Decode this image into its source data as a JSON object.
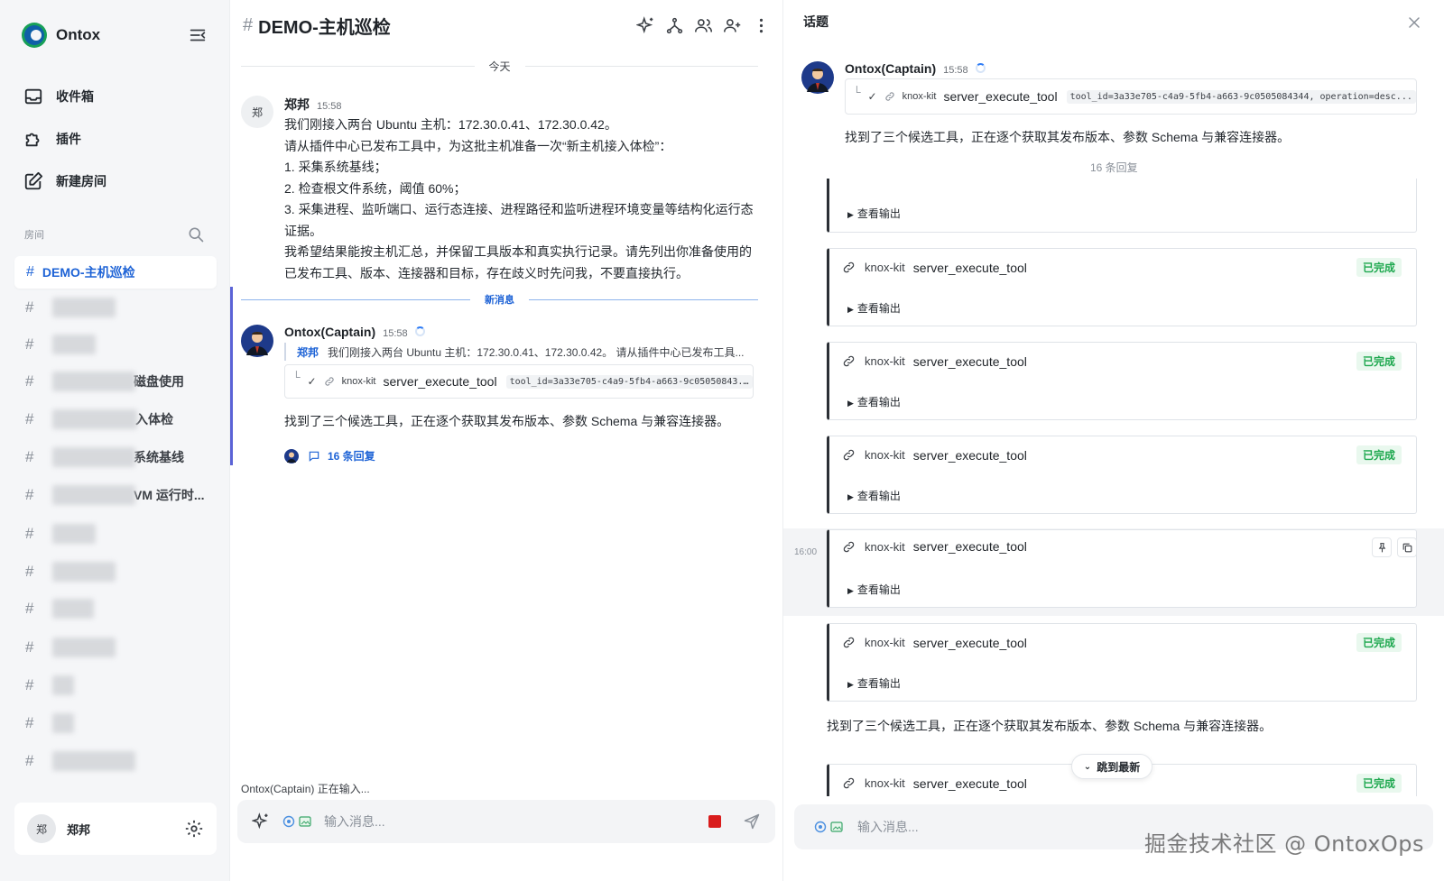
{
  "app": {
    "name": "Ontox"
  },
  "sidebar": {
    "nav": [
      {
        "label": "收件箱",
        "icon": "inbox-icon"
      },
      {
        "label": "插件",
        "icon": "puzzle-icon"
      },
      {
        "label": "新建房间",
        "icon": "edit-icon"
      }
    ],
    "rooms_header": "房间",
    "active_room": "DEMO-主机巡检",
    "rooms": [
      {
        "tail": ""
      },
      {
        "tail": ""
      },
      {
        "tail": "磁盘使用"
      },
      {
        "tail": "入体检"
      },
      {
        "tail": "系统基线"
      },
      {
        "tail": "VM 运行时..."
      },
      {
        "tail": ""
      },
      {
        "tail": ""
      },
      {
        "tail": ""
      },
      {
        "tail": ""
      },
      {
        "tail": ""
      },
      {
        "tail": ""
      },
      {
        "tail": ""
      }
    ],
    "user": {
      "avatar_letter": "郑",
      "name": "郑邦"
    }
  },
  "chat": {
    "title": "DEMO-主机巡检",
    "date_divider": "今天",
    "new_divider": "新消息",
    "user_msg": {
      "avatar_letter": "郑",
      "name": "郑邦",
      "time": "15:58",
      "lines": [
        "我们刚接入两台 Ubuntu 主机：172.30.0.41、172.30.0.42。",
        "请从插件中心已发布工具中，为这批主机准备一次“新主机接入体检”：",
        "1. 采集系统基线；",
        "2. 检查根文件系统，阈值 60%；",
        "3. 采集进程、监听端口、运行态连接、进程路径和监听进程环境变量等结构化运行态证据。",
        "我希望结果能按主机汇总，并保留工具版本和真实执行记录。请先列出你准备使用的已发布工具、版本、连接器和目标，存在歧义时先问我，不要直接执行。"
      ]
    },
    "bot_msg": {
      "name": "Ontox(Captain)",
      "time": "15:58",
      "quote_name": "郑邦",
      "quote_text": "我们刚接入两台 Ubuntu 主机：172.30.0.41、172.30.0.42。 请从插件中心已发布工具...",
      "tool": {
        "kit": "knox-kit",
        "name": "server_execute_tool",
        "args": "tool_id=3a33e705-c4a9-5fb4-a663-9c05050843..."
      },
      "text": "找到了三个候选工具，正在逐个获取其发布版本、参数 Schema 与兼容连接器。",
      "replies": "16 条回复"
    },
    "typing": "Ontox(Captain) 正在输入...",
    "composer_placeholder": "输入消息..."
  },
  "thread": {
    "title": "话题",
    "root": {
      "name": "Ontox(Captain)",
      "time": "15:58",
      "tool": {
        "kit": "knox-kit",
        "name": "server_execute_tool",
        "args": "tool_id=3a33e705-c4a9-5fb4-a663-9c0505084344, operation=desc..."
      },
      "text": "找到了三个候选工具，正在逐个获取其发布版本、参数 Schema 与兼容连接器。"
    },
    "reply_count": "16 条回复",
    "view_output": "查看输出",
    "cards": [
      {
        "kit": "knox-kit",
        "name": "server_execute_tool",
        "status": "已完成"
      },
      {
        "kit": "knox-kit",
        "name": "server_execute_tool",
        "status": "已完成"
      },
      {
        "kit": "knox-kit",
        "name": "server_execute_tool",
        "status": "已完成"
      },
      {
        "kit": "knox-kit",
        "name": "server_execute_tool",
        "status": ""
      },
      {
        "kit": "knox-kit",
        "name": "server_execute_tool",
        "status": "已完成"
      },
      {
        "kit": "knox-kit",
        "name": "server_execute_tool",
        "status": "已完成"
      }
    ],
    "hover_time": "16:00",
    "tail_text": "找到了三个候选工具，正在逐个获取其发布版本、参数 Schema 与兼容连接器。",
    "jump_latest": "跳到最新",
    "composer_placeholder": "输入消息...",
    "watermark": "掘金技术社区 @ OntoxOps"
  },
  "colors": {
    "accent": "#1e63d6",
    "success": "#1ea84f",
    "bot_bar": "#5b63d6",
    "stop": "#d91c1c"
  }
}
